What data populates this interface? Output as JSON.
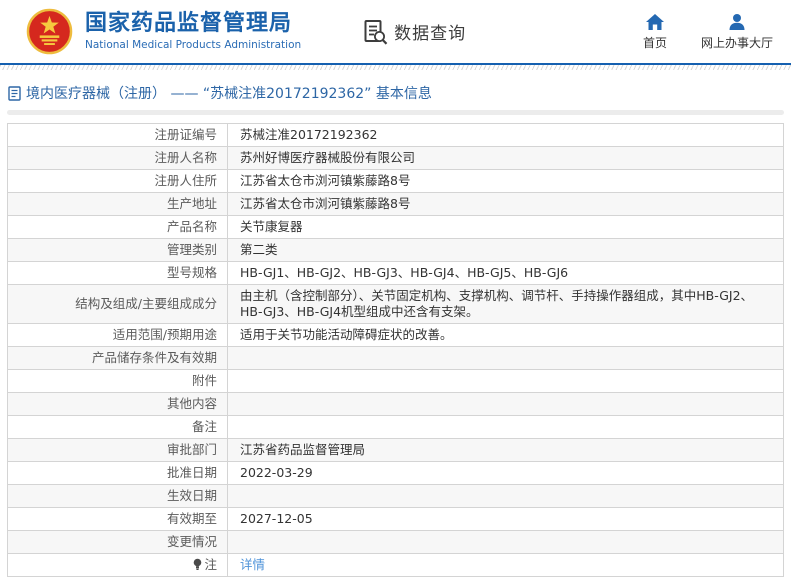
{
  "header": {
    "agency_name_cn": "国家药品监督管理局",
    "agency_name_en": "National Medical Products Administration",
    "module_title": "数据查询",
    "nav": [
      {
        "label": "首页",
        "icon": "home-icon"
      },
      {
        "label": "网上办事大厅",
        "icon": "person-icon"
      }
    ]
  },
  "breadcrumb": {
    "title": "境内医疗器械（注册） —— “苏械注准20172192362” 基本信息"
  },
  "table": {
    "rows": [
      {
        "label": "注册证编号",
        "value": "苏械注准20172192362"
      },
      {
        "label": "注册人名称",
        "value": "苏州好博医疗器械股份有限公司"
      },
      {
        "label": "注册人住所",
        "value": "江苏省太仓市浏河镇紫藤路8号"
      },
      {
        "label": "生产地址",
        "value": "江苏省太仓市浏河镇紫藤路8号"
      },
      {
        "label": "产品名称",
        "value": "关节康复器"
      },
      {
        "label": "管理类别",
        "value": "第二类"
      },
      {
        "label": "型号规格",
        "value": "HB-GJ1、HB-GJ2、HB-GJ3、HB-GJ4、HB-GJ5、HB-GJ6"
      },
      {
        "label": "结构及组成/主要组成成分",
        "value": "由主机（含控制部分）、关节固定机构、支撑机构、调节杆、手持操作器组成，其中HB-GJ2、HB-GJ3、HB-GJ4机型组成中还含有支架。"
      },
      {
        "label": "适用范围/预期用途",
        "value": "适用于关节功能活动障碍症状的改善。"
      },
      {
        "label": "产品储存条件及有效期",
        "value": ""
      },
      {
        "label": "附件",
        "value": ""
      },
      {
        "label": "其他内容",
        "value": ""
      },
      {
        "label": "备注",
        "value": ""
      },
      {
        "label": "审批部门",
        "value": "江苏省药品监督管理局"
      },
      {
        "label": "批准日期",
        "value": "2022-03-29"
      },
      {
        "label": "生效日期",
        "value": ""
      },
      {
        "label": "有效期至",
        "value": "2027-12-05"
      },
      {
        "label": "变更情况",
        "value": ""
      },
      {
        "label": "注",
        "value": "详情",
        "value_is_link": true,
        "label_icon": "lightbulb-icon"
      }
    ]
  },
  "colors": {
    "header_blue": "#1b62ab",
    "rule_blue": "#1560b0",
    "title_blue": "#2d66a5",
    "link_blue": "#4e93d9",
    "emblem_red": "#d5281e",
    "emblem_gold": "#eebc3e",
    "stripe_gray": "#f7f7f7",
    "border_gray": "#d4d4d4"
  }
}
